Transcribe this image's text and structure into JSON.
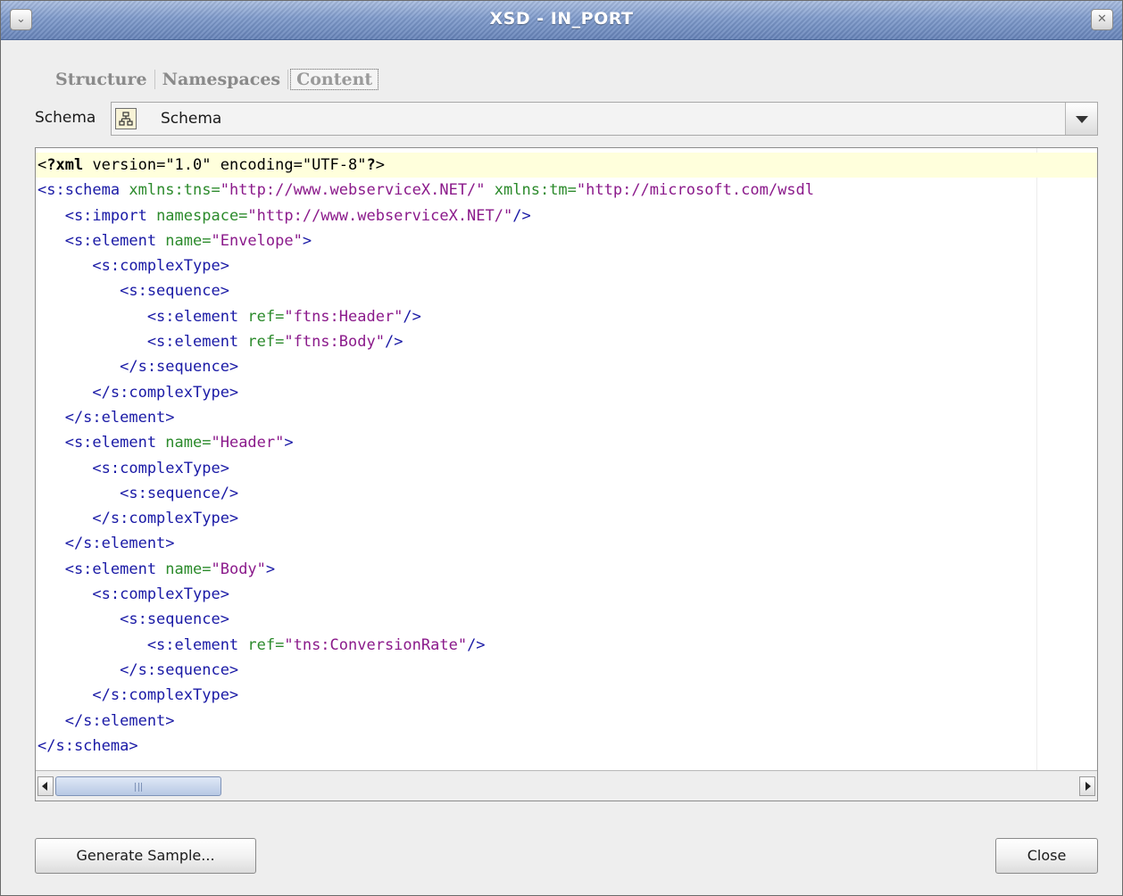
{
  "window": {
    "title": "XSD - IN_PORT",
    "menu_icon": "chevron-down-icon",
    "close_icon": "close-x-icon"
  },
  "tabs": [
    {
      "label": "Structure",
      "active": false
    },
    {
      "label": "Namespaces",
      "active": false
    },
    {
      "label": "Content",
      "active": true
    }
  ],
  "schema_selector": {
    "label": "Schema",
    "icon": "schema-tree-icon",
    "value": "Schema"
  },
  "editor": {
    "lines": [
      [
        {
          "c": "plain",
          "t": "<"
        },
        {
          "c": "pi",
          "t": "?xml"
        },
        {
          "c": "plain",
          "t": " version=\"1.0\" encoding=\"UTF-8\""
        },
        {
          "c": "pi",
          "t": "?"
        },
        {
          "c": "plain",
          "t": ">"
        }
      ],
      [
        {
          "c": "tag",
          "t": "<s:schema "
        },
        {
          "c": "attr",
          "t": "xmlns:tns="
        },
        {
          "c": "val",
          "t": "\"http://www.webserviceX.NET/\""
        },
        {
          "c": "plain",
          "t": " "
        },
        {
          "c": "attr",
          "t": "xmlns:tm="
        },
        {
          "c": "val",
          "t": "\"http://microsoft.com/wsdl"
        }
      ],
      [
        {
          "c": "tag",
          "t": "   <s:import "
        },
        {
          "c": "attr",
          "t": "namespace="
        },
        {
          "c": "val",
          "t": "\"http://www.webserviceX.NET/\""
        },
        {
          "c": "tag",
          "t": "/>"
        }
      ],
      [
        {
          "c": "tag",
          "t": "   <s:element "
        },
        {
          "c": "attr",
          "t": "name="
        },
        {
          "c": "val",
          "t": "\"Envelope\""
        },
        {
          "c": "tag",
          "t": ">"
        }
      ],
      [
        {
          "c": "tag",
          "t": "      <s:complexType>"
        }
      ],
      [
        {
          "c": "tag",
          "t": "         <s:sequence>"
        }
      ],
      [
        {
          "c": "tag",
          "t": "            <s:element "
        },
        {
          "c": "attr",
          "t": "ref="
        },
        {
          "c": "val",
          "t": "\"ftns:Header\""
        },
        {
          "c": "tag",
          "t": "/>"
        }
      ],
      [
        {
          "c": "tag",
          "t": "            <s:element "
        },
        {
          "c": "attr",
          "t": "ref="
        },
        {
          "c": "val",
          "t": "\"ftns:Body\""
        },
        {
          "c": "tag",
          "t": "/>"
        }
      ],
      [
        {
          "c": "tag",
          "t": "         </s:sequence>"
        }
      ],
      [
        {
          "c": "tag",
          "t": "      </s:complexType>"
        }
      ],
      [
        {
          "c": "tag",
          "t": "   </s:element>"
        }
      ],
      [
        {
          "c": "tag",
          "t": "   <s:element "
        },
        {
          "c": "attr",
          "t": "name="
        },
        {
          "c": "val",
          "t": "\"Header\""
        },
        {
          "c": "tag",
          "t": ">"
        }
      ],
      [
        {
          "c": "tag",
          "t": "      <s:complexType>"
        }
      ],
      [
        {
          "c": "tag",
          "t": "         <s:sequence/>"
        }
      ],
      [
        {
          "c": "tag",
          "t": "      </s:complexType>"
        }
      ],
      [
        {
          "c": "tag",
          "t": "   </s:element>"
        }
      ],
      [
        {
          "c": "tag",
          "t": "   <s:element "
        },
        {
          "c": "attr",
          "t": "name="
        },
        {
          "c": "val",
          "t": "\"Body\""
        },
        {
          "c": "tag",
          "t": ">"
        }
      ],
      [
        {
          "c": "tag",
          "t": "      <s:complexType>"
        }
      ],
      [
        {
          "c": "tag",
          "t": "         <s:sequence>"
        }
      ],
      [
        {
          "c": "tag",
          "t": "            <s:element "
        },
        {
          "c": "attr",
          "t": "ref="
        },
        {
          "c": "val",
          "t": "\"tns:ConversionRate\""
        },
        {
          "c": "tag",
          "t": "/>"
        }
      ],
      [
        {
          "c": "tag",
          "t": "         </s:sequence>"
        }
      ],
      [
        {
          "c": "tag",
          "t": "      </s:complexType>"
        }
      ],
      [
        {
          "c": "tag",
          "t": "   </s:element>"
        }
      ],
      [
        {
          "c": "tag",
          "t": "</s:schema>"
        }
      ]
    ],
    "current_line": 0
  },
  "buttons": {
    "generate_label": "Generate Sample...",
    "close_label": "Close"
  },
  "colors": {
    "tag": "#1a1aa6",
    "attribute": "#2b8a2b",
    "value": "#8b1a8b",
    "current_line_bg": "#ffffdc",
    "titlebar": "#7b96c5"
  }
}
